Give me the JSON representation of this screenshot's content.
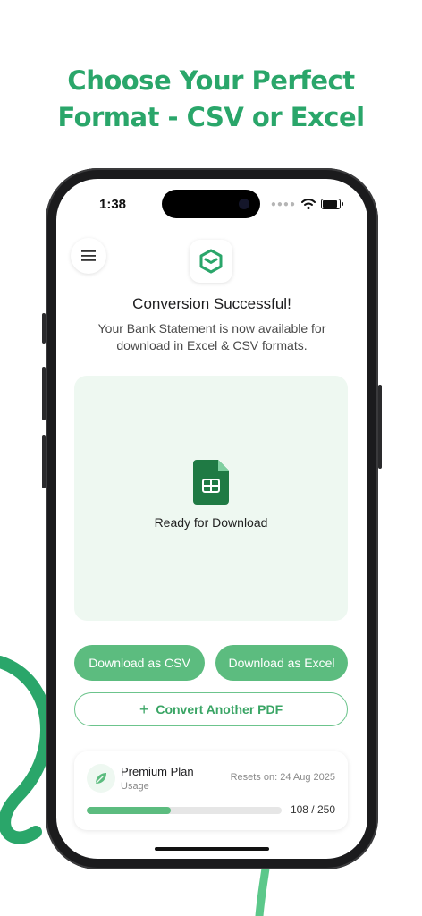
{
  "headline": {
    "line1": "Choose Your Perfect",
    "line2": "Format - CSV or Excel"
  },
  "status_bar": {
    "time": "1:38"
  },
  "app": {
    "title": "Conversion Successful!",
    "subtitle": "Your Bank Statement is now available for download in Excel & CSV formats.",
    "card": {
      "label": "Ready for Download"
    },
    "buttons": {
      "csv": "Download as CSV",
      "excel": "Download as Excel",
      "convert": "Convert Another PDF"
    },
    "plan": {
      "name": "Premium Plan",
      "sub": "Usage",
      "reset": "Resets on: 24 Aug 2025",
      "used": 108,
      "limit": 250,
      "count_text": "108 / 250"
    }
  },
  "colors": {
    "accent": "#2aa66a",
    "button_green": "#5cbc7f",
    "card_bg": "#eef8f1",
    "excel_green": "#1f7a44"
  },
  "icons": [
    "menu-icon",
    "app-logo-icon",
    "spreadsheet-file-icon",
    "plus-icon",
    "leaf-icon",
    "wifi-icon",
    "battery-icon",
    "signal-dots-icon"
  ]
}
